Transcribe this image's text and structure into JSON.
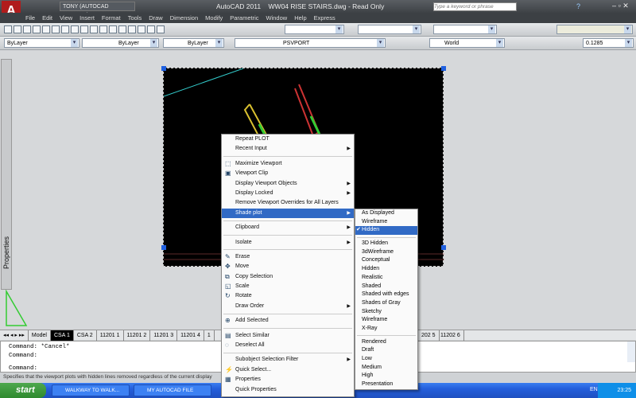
{
  "app": {
    "title": "AutoCAD 2011    WW04 RISE STAIRS.dwg - Read Only",
    "workspace": "TONY (AUTOCAD CLASSIC)",
    "search_placeholder": "Type a keyword or phrase"
  },
  "menubar": [
    "File",
    "Edit",
    "View",
    "Insert",
    "Format",
    "Tools",
    "Draw",
    "Dimension",
    "Modify",
    "Parametric",
    "Window",
    "Help",
    "Express"
  ],
  "properties_bar": {
    "color": "ByLayer",
    "linetype": "ByLayer",
    "lineweight": "ByLayer",
    "layer": "PSVPORT",
    "ucs": "World",
    "scale": "0.1285"
  },
  "left_palette": {
    "label": "Properties"
  },
  "context_menu": {
    "items": [
      {
        "label": "Repeat PLOT"
      },
      {
        "label": "Recent Input",
        "submenu": true
      },
      {
        "sep": true
      },
      {
        "label": "Maximize Viewport",
        "icon": "maximize-icon"
      },
      {
        "label": "Viewport Clip",
        "icon": "clip-icon"
      },
      {
        "label": "Display Viewport Objects",
        "submenu": true
      },
      {
        "label": "Display Locked",
        "submenu": true
      },
      {
        "label": "Remove Viewport Overrides for All Layers"
      },
      {
        "label": "Shade plot",
        "submenu": true,
        "selected": true
      },
      {
        "sep": true
      },
      {
        "label": "Clipboard",
        "submenu": true
      },
      {
        "sep": true
      },
      {
        "label": "Isolate",
        "submenu": true
      },
      {
        "sep": true
      },
      {
        "label": "Erase",
        "icon": "erase-icon"
      },
      {
        "label": "Move",
        "icon": "move-icon"
      },
      {
        "label": "Copy Selection",
        "icon": "copy-icon"
      },
      {
        "label": "Scale",
        "icon": "scale-icon"
      },
      {
        "label": "Rotate",
        "icon": "rotate-icon"
      },
      {
        "label": "Draw Order",
        "submenu": true
      },
      {
        "sep": true
      },
      {
        "label": "Add Selected",
        "icon": "add-selected-icon"
      },
      {
        "sep": true
      },
      {
        "label": "Select Similar",
        "icon": "select-similar-icon"
      },
      {
        "label": "Deselect All",
        "icon": "deselect-icon"
      },
      {
        "sep": true
      },
      {
        "label": "Subobject Selection Filter",
        "submenu": true
      },
      {
        "label": "Quick Select...",
        "icon": "quick-select-icon"
      },
      {
        "label": "Properties",
        "icon": "properties-icon"
      },
      {
        "label": "Quick Properties"
      }
    ]
  },
  "shade_submenu": {
    "items": [
      {
        "label": "As Displayed"
      },
      {
        "label": "Wireframe"
      },
      {
        "label": "Hidden",
        "checked": true
      },
      {
        "sep": true
      },
      {
        "label": "3D Hidden"
      },
      {
        "label": "3dWireframe"
      },
      {
        "label": "Conceptual"
      },
      {
        "label": "Hidden"
      },
      {
        "label": "Realistic"
      },
      {
        "label": "Shaded"
      },
      {
        "label": "Shaded with edges"
      },
      {
        "label": "Shades of Gray"
      },
      {
        "label": "Sketchy"
      },
      {
        "label": "Wireframe"
      },
      {
        "label": "X-Ray"
      },
      {
        "sep": true
      },
      {
        "label": "Rendered"
      },
      {
        "label": "Draft"
      },
      {
        "label": "Low"
      },
      {
        "label": "Medium"
      },
      {
        "label": "High"
      },
      {
        "label": "Presentation"
      }
    ]
  },
  "layout_tabs": [
    "Model",
    "CSA 1",
    "CSA 2",
    "11201 1",
    "11201 2",
    "11201 3",
    "11201 4",
    "1",
    "202 5",
    "11202 6"
  ],
  "active_tab": "CSA 1",
  "command_lines": [
    "Command: *Cancel*",
    "Command:",
    "Command:"
  ],
  "status_text": "Specifies that the viewport plots with hidden lines removed regardless of the current display",
  "taskbar": {
    "start": "start",
    "tasks": [
      "WALKWAY TO WALK...",
      "MY AUTOCAD FILE"
    ],
    "lang": "EN",
    "clock": "23:25"
  }
}
